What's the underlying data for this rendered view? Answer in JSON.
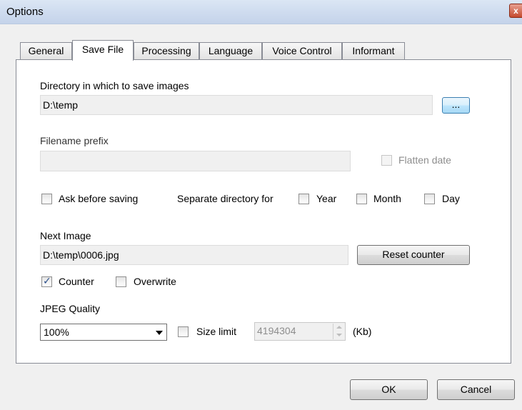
{
  "window": {
    "title": "Options",
    "close_glyph": "x"
  },
  "tabs": [
    {
      "label": "General"
    },
    {
      "label": "Save File"
    },
    {
      "label": "Processing"
    },
    {
      "label": "Language"
    },
    {
      "label": "Voice Control"
    },
    {
      "label": "Informant"
    }
  ],
  "active_tab": "Save File",
  "save_file": {
    "directory_label": "Directory in which to save images",
    "directory_value": "D:\\temp",
    "browse_label": "...",
    "prefix_label": "Filename prefix",
    "prefix_value": "",
    "flatten_date_label": "Flatten date",
    "flatten_date_checked": false,
    "ask_before_saving_label": "Ask before saving",
    "ask_before_saving_checked": false,
    "separate_dir_label": "Separate directory for",
    "year_label": "Year",
    "year_checked": false,
    "month_label": "Month",
    "month_checked": false,
    "day_label": "Day",
    "day_checked": false,
    "next_image_label": "Next Image",
    "next_image_value": "D:\\temp\\0006.jpg",
    "reset_counter_label": "Reset counter",
    "counter_label": "Counter",
    "counter_checked": true,
    "overwrite_label": "Overwrite",
    "overwrite_checked": false,
    "jpeg_quality_label": "JPEG Quality",
    "jpeg_quality_value": "100%",
    "size_limit_label": "Size limit",
    "size_limit_checked": false,
    "size_limit_value": "4194304",
    "size_unit": "(Kb)"
  },
  "footer": {
    "ok_label": "OK",
    "cancel_label": "Cancel"
  },
  "icons": {
    "check_mark": "✓"
  }
}
